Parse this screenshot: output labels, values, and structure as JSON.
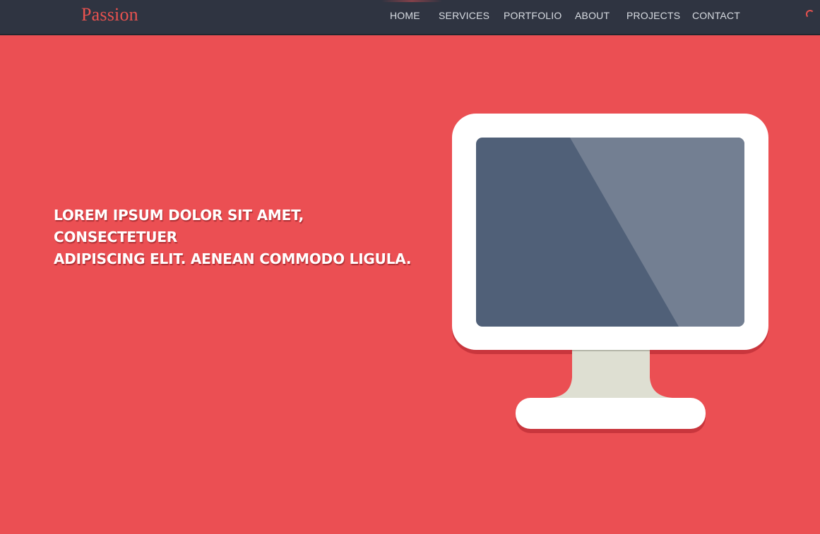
{
  "brand": {
    "name": "Passion",
    "color": "#e8524f"
  },
  "nav": {
    "items": [
      {
        "label": "HOME"
      },
      {
        "label": "SERVICES"
      },
      {
        "label": "PORTFOLIO"
      },
      {
        "label": "ABOUT"
      },
      {
        "label": "PROJECTS"
      },
      {
        "label": "CONTACT"
      }
    ]
  },
  "hero": {
    "headline_line1": "LOREM IPSUM DOLOR SIT AMET, CONSECTETUER",
    "headline_line2": "ADIPISCING ELIT. AENEAN COMMODO LIGULA."
  },
  "icons": {
    "hero_illustration": "monitor-icon",
    "loading_indicator": "spinner-icon"
  },
  "colors": {
    "background": "#eb4f53",
    "navbar": "#2f3441",
    "screen": "#506078",
    "screen_glare": "#737f92",
    "monitor_frame": "#ffffff",
    "monitor_stand": "#dedfd2"
  }
}
